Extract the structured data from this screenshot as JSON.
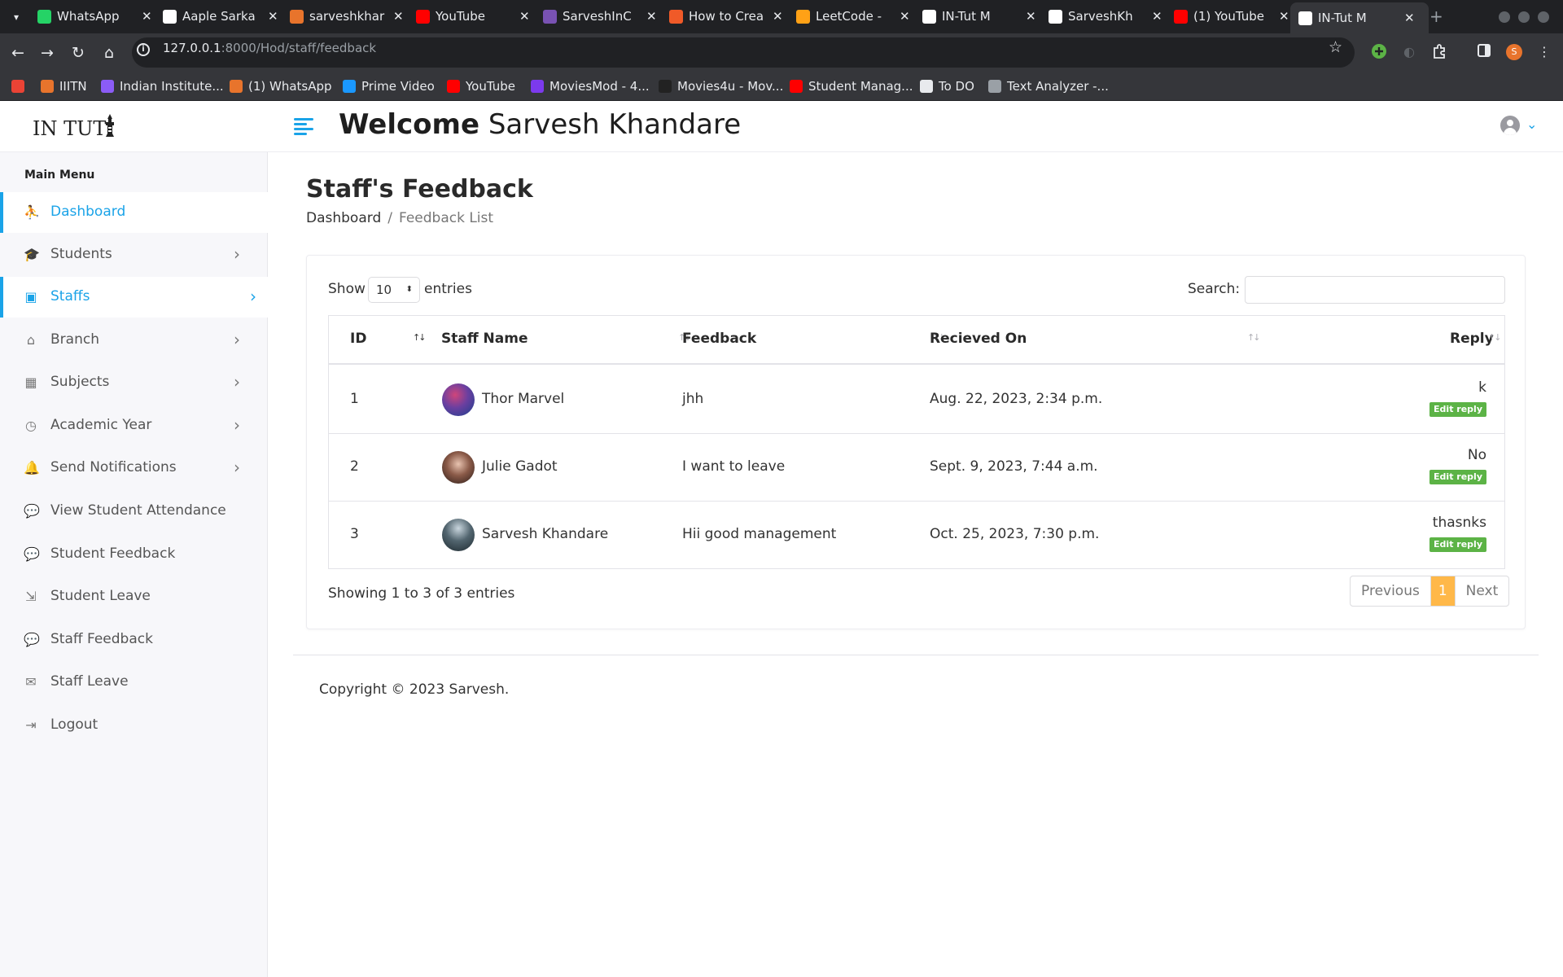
{
  "browser": {
    "tabs": [
      {
        "title": "WhatsApp",
        "favicon_color": "#25d366",
        "favicon": "whatsapp-icon"
      },
      {
        "title": "Aaple Sarka",
        "favicon_color": "#ffffff",
        "favicon": "document-icon"
      },
      {
        "title": "sarveshkhar",
        "favicon_color": "#e8742c",
        "favicon": "bolt-icon"
      },
      {
        "title": "YouTube",
        "favicon_color": "#ff0000",
        "favicon": "youtube-icon"
      },
      {
        "title": "SarveshInC",
        "favicon_color": "#7952b3",
        "favicon": "bootstrap-icon"
      },
      {
        "title": "How to Crea",
        "favicon_color": "#f05a28",
        "favicon": "hashnode-icon"
      },
      {
        "title": "LeetCode -",
        "favicon_color": "#ffa116",
        "favicon": "leetcode-icon"
      },
      {
        "title": "IN-Tut M",
        "favicon_color": "#ffffff",
        "favicon": "intut-icon"
      },
      {
        "title": "SarveshKh",
        "favicon_color": "#ffffff",
        "favicon": "github-icon"
      },
      {
        "title": "(1) YouTube",
        "favicon_color": "#ff0000",
        "favicon": "youtube-icon"
      },
      {
        "title": "IN-Tut M",
        "favicon_color": "#ffffff",
        "favicon": "intut-icon"
      }
    ],
    "url_host": "127.0.0.1",
    "url_rest": ":8000/Hod/staff/feedback",
    "profile_initial": "S",
    "bookmarks": [
      {
        "label": "",
        "color": "#ea4335",
        "icon": "gmail-icon"
      },
      {
        "label": "IIITN",
        "color": "#e8742c",
        "icon": "iiitn-icon"
      },
      {
        "label": "Indian Institute...",
        "color": "#8b5cf6",
        "icon": "institute-icon"
      },
      {
        "label": "(1) WhatsApp",
        "color": "#e8742c",
        "icon": "whatsapp-icon"
      },
      {
        "label": "Prime Video",
        "color": "#1a98ff",
        "icon": "prime-video-icon"
      },
      {
        "label": "YouTube",
        "color": "#ff0000",
        "icon": "youtube-icon"
      },
      {
        "label": "MoviesMod - 4...",
        "color": "#7c3aed",
        "icon": "moviesmod-icon"
      },
      {
        "label": "Movies4u - Mov...",
        "color": "#222222",
        "icon": "movies4u-icon"
      },
      {
        "label": "Student Manag...",
        "color": "#ff0000",
        "icon": "youtube-icon"
      },
      {
        "label": "To DO",
        "color": "#e8eaed",
        "icon": "globe-icon"
      },
      {
        "label": "Text Analyzer -...",
        "color": "#9aa0a6",
        "icon": "gear-icon"
      }
    ]
  },
  "sidebar": {
    "logo": "IN TUT",
    "menu_title": "Main Menu",
    "items": [
      {
        "label": "Dashboard",
        "icon": "dashboard-icon",
        "active": true,
        "has_chevron": false
      },
      {
        "label": "Students",
        "icon": "students-icon",
        "active": false,
        "has_chevron": true
      },
      {
        "label": "Staffs",
        "icon": "staffs-icon",
        "active": true,
        "has_chevron": true
      },
      {
        "label": "Branch",
        "icon": "branch-icon",
        "active": false,
        "has_chevron": true
      },
      {
        "label": "Subjects",
        "icon": "subjects-icon",
        "active": false,
        "has_chevron": true
      },
      {
        "label": "Academic Year",
        "icon": "clock-icon",
        "active": false,
        "has_chevron": true
      },
      {
        "label": "Send Notifications",
        "icon": "bell-icon",
        "active": false,
        "has_chevron": true
      },
      {
        "label": "View Student Attendance",
        "icon": "comments-icon",
        "active": false,
        "has_chevron": false
      },
      {
        "label": "Student Feedback",
        "icon": "comments-icon",
        "active": false,
        "has_chevron": false
      },
      {
        "label": "Student Leave",
        "icon": "leave-icon",
        "active": false,
        "has_chevron": false
      },
      {
        "label": "Staff Feedback",
        "icon": "comments-icon",
        "active": false,
        "has_chevron": false
      },
      {
        "label": "Staff Leave",
        "icon": "envelope-icon",
        "active": false,
        "has_chevron": false
      },
      {
        "label": "Logout",
        "icon": "logout-icon",
        "active": false,
        "has_chevron": false
      }
    ]
  },
  "header": {
    "welcome": "Welcome",
    "user_name": "Sarvesh Khandare"
  },
  "page": {
    "title": "Staff's Feedback",
    "breadcrumb": [
      "Dashboard",
      "Feedback List"
    ],
    "show_label": "Show",
    "entries_value": "10",
    "entries_label": "entries",
    "search_label": "Search:",
    "search_value": "",
    "columns": [
      "ID",
      "Staff Name",
      "Feedback",
      "Recieved On",
      "Reply"
    ],
    "rows": [
      {
        "id": "1",
        "name": "Thor Marvel",
        "feedback": "jhh",
        "received": "Aug. 22, 2023, 2:34 p.m.",
        "reply": "k",
        "action": "Edit reply"
      },
      {
        "id": "2",
        "name": "Julie Gadot",
        "feedback": "I want to leave",
        "received": "Sept. 9, 2023, 7:44 a.m.",
        "reply": "No",
        "action": "Edit reply"
      },
      {
        "id": "3",
        "name": "Sarvesh Khandare",
        "feedback": "Hii good management",
        "received": "Oct. 25, 2023, 7:30 p.m.",
        "reply": "thasnks",
        "action": "Edit reply"
      }
    ],
    "info": "Showing 1 to 3 of 3 entries",
    "pagination": {
      "previous": "Previous",
      "current": "1",
      "next": "Next"
    }
  },
  "footer": {
    "copyright": "Copyright © 2023 Sarvesh."
  },
  "colors": {
    "accent": "#1aa3e8",
    "success": "#5cb346",
    "page_active": "#ffb849"
  }
}
